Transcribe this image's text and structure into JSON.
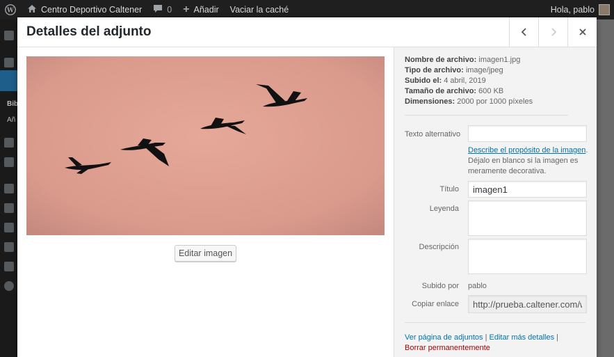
{
  "adminbar": {
    "site_name": "Centro Deportivo Caltener",
    "comments_count": "0",
    "add_new": "Añadir",
    "purge_cache": "Vaciar la caché",
    "greeting": "Hola, pablo"
  },
  "sidebar": {
    "labels": [
      "Bib",
      "Añ"
    ]
  },
  "modal": {
    "title": "Detalles del adjunto"
  },
  "media": {
    "edit_image_label": "Editar imagen"
  },
  "details": {
    "meta": [
      {
        "label": "Nombre de archivo:",
        "value": "imagen1.jpg"
      },
      {
        "label": "Tipo de archivo:",
        "value": "image/jpeg"
      },
      {
        "label": "Subido el:",
        "value": "4 abril, 2019"
      },
      {
        "label": "Tamaño de archivo:",
        "value": "600 KB"
      },
      {
        "label": "Dimensiones:",
        "value": "2000 por 1000 píxeles"
      }
    ],
    "alt_label": "Texto alternativo",
    "alt_value": "",
    "alt_help_link": "Describe el propósito de la imagen",
    "alt_help_rest": ". Déjalo en blanco si la imagen es meramente decorativa.",
    "title_label": "Título",
    "title_value": "imagen1",
    "caption_label": "Leyenda",
    "caption_value": "",
    "description_label": "Descripción",
    "description_value": "",
    "uploaded_by_label": "Subido por",
    "uploaded_by_value": "pablo",
    "copy_link_label": "Copiar enlace",
    "copy_link_value": "http://prueba.caltener.com/w",
    "links": {
      "view_page": "Ver página de adjuntos",
      "sep1": " | ",
      "edit_more": "Editar más detalles",
      "sep2": " |",
      "delete": "Borrar permanentemente"
    }
  },
  "colors": {
    "sky": "#e0a394",
    "bird": "#111111",
    "link": "#0073aa",
    "delete": "#aa0000"
  }
}
